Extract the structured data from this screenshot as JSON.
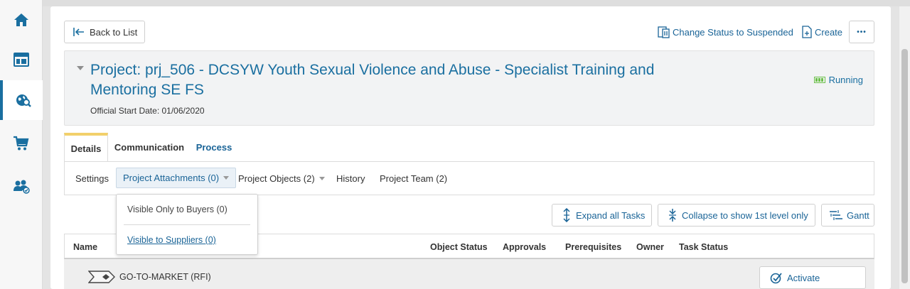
{
  "nav": {
    "items": [
      {
        "icon": "home-icon",
        "active": false
      },
      {
        "icon": "dashboard-icon",
        "active": false
      },
      {
        "icon": "global-search-icon",
        "active": true
      },
      {
        "icon": "cart-icon",
        "active": false
      },
      {
        "icon": "users-icon",
        "active": false
      }
    ]
  },
  "toolbar": {
    "back_label": "Back to List",
    "change_status_label": "Change Status to Suspended",
    "create_label": "Create",
    "more_label": "•••"
  },
  "project": {
    "title": "Project: prj_506 - DCSYW Youth Sexual Violence and Abuse - Specialist Training and Mentoring SE FS",
    "start_date": "Official Start Date: 01/06/2020",
    "status": "Running"
  },
  "tabs": [
    {
      "label": "Details"
    },
    {
      "label": "Communication"
    },
    {
      "label": "Process"
    }
  ],
  "subtabs": {
    "settings": "Settings",
    "attachments": "Project Attachments (0)",
    "objects": "Project Objects (2)",
    "history": "History",
    "team": "Project Team (2)"
  },
  "dropdown": {
    "buyers": "Visible Only to Buyers (0)",
    "suppliers": "Visible to Suppliers (0)"
  },
  "actions": {
    "expand": "Expand all Tasks",
    "collapse": "Collapse to show 1st level only",
    "gantt": "Gantt"
  },
  "table": {
    "columns": [
      "Name",
      "Object Status",
      "Approvals",
      "Prerequisites",
      "Owner",
      "Task Status"
    ],
    "rows": [
      {
        "name": "GO-TO-MARKET (RFI)",
        "action": "Activate"
      }
    ]
  },
  "colors": {
    "accent": "#1a6fa0",
    "link": "#1a6497",
    "status_green": "#6cc04a",
    "tab_highlight": "#f2d06b"
  }
}
